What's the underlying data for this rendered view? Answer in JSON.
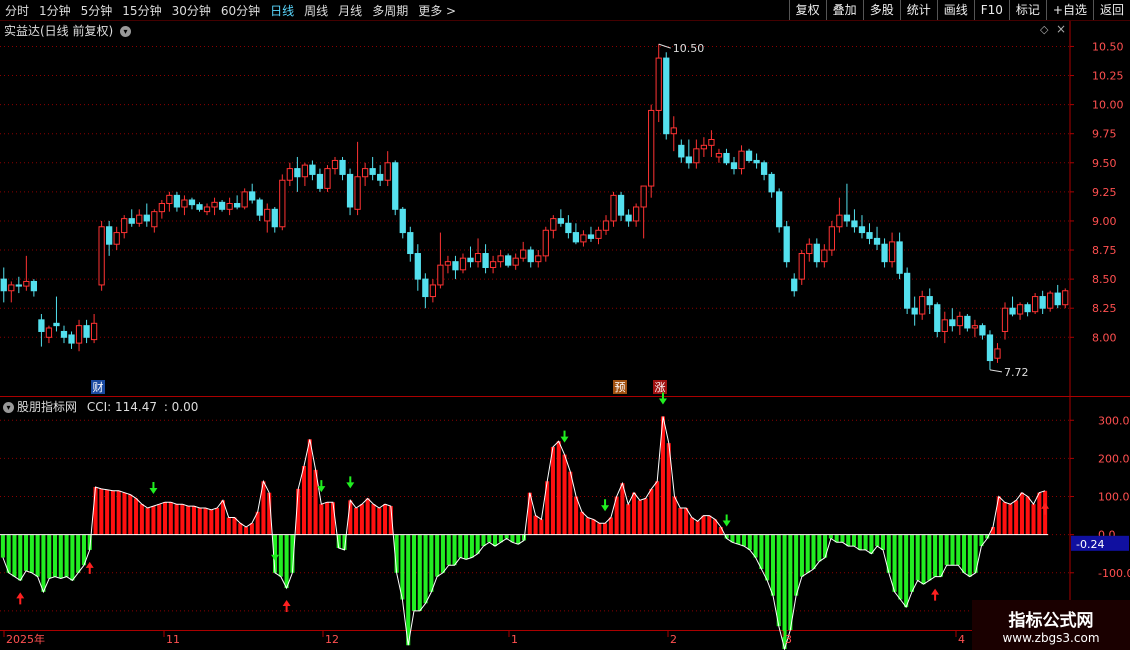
{
  "toolbar": {
    "timeframes": [
      "分时",
      "1分钟",
      "5分钟",
      "15分钟",
      "30分钟",
      "60分钟",
      "日线",
      "周线",
      "月线",
      "多周期",
      "更多 >"
    ],
    "active_index": 6,
    "right_buttons": [
      "复权",
      "叠加",
      "多股",
      "统计",
      "画线",
      "F10",
      "标记",
      "+自选",
      "返回"
    ]
  },
  "main_panel": {
    "title": "实益达(日线 前复权)",
    "badges": [
      "财",
      "预",
      "涨"
    ],
    "high_label": "10.50",
    "low_label": "7.72"
  },
  "indicator_panel": {
    "title": "股朋指标网",
    "cci_label": "CCI: 114.47",
    "extra_label": ": 0.00",
    "current_value_label": "-0.24"
  },
  "x_axis_labels": [
    "2025年",
    "11",
    "12",
    "1",
    "2",
    "3",
    "4"
  ],
  "watermark": {
    "title": "指标公式网",
    "url": "www.zbgs3.com"
  },
  "colors": {
    "up": "#ff3333",
    "down": "#54e0ee",
    "cci_pos": "#ff1010",
    "cci_neg": "#22ee22",
    "grid": "#8a0000"
  },
  "chart_data": [
    {
      "type": "candlestick",
      "title": "实益达(日线 前复权)",
      "ylim": [
        7.65,
        10.65
      ],
      "yticks": [
        8.0,
        8.25,
        8.5,
        8.75,
        9.0,
        9.25,
        9.5,
        9.75,
        10.0,
        10.25,
        10.5
      ],
      "ohlc": [
        [
          8.5,
          8.6,
          8.3,
          8.4
        ],
        [
          8.4,
          8.48,
          8.3,
          8.45
        ],
        [
          8.45,
          8.52,
          8.38,
          8.44
        ],
        [
          8.44,
          8.7,
          8.4,
          8.48
        ],
        [
          8.48,
          8.5,
          8.35,
          8.4
        ],
        [
          8.15,
          8.2,
          7.92,
          8.05
        ],
        [
          8.0,
          8.1,
          7.95,
          8.08
        ],
        [
          8.12,
          8.35,
          8.05,
          8.1
        ],
        [
          8.05,
          8.1,
          7.95,
          8.0
        ],
        [
          8.02,
          8.05,
          7.9,
          7.95
        ],
        [
          7.95,
          8.15,
          7.88,
          8.1
        ],
        [
          8.1,
          8.15,
          7.95,
          8.0
        ],
        [
          7.98,
          8.2,
          7.95,
          8.12
        ],
        [
          8.45,
          9.0,
          8.4,
          8.95
        ],
        [
          8.95,
          9.0,
          8.7,
          8.8
        ],
        [
          8.8,
          8.95,
          8.75,
          8.9
        ],
        [
          8.9,
          9.05,
          8.85,
          9.02
        ],
        [
          9.02,
          9.1,
          8.95,
          8.98
        ],
        [
          8.98,
          9.1,
          8.95,
          9.05
        ],
        [
          9.05,
          9.15,
          8.95,
          9.0
        ],
        [
          8.95,
          9.1,
          8.9,
          9.08
        ],
        [
          9.08,
          9.18,
          9.02,
          9.15
        ],
        [
          9.15,
          9.25,
          9.08,
          9.22
        ],
        [
          9.22,
          9.25,
          9.08,
          9.12
        ],
        [
          9.12,
          9.22,
          9.05,
          9.18
        ],
        [
          9.18,
          9.2,
          9.1,
          9.14
        ],
        [
          9.14,
          9.16,
          9.08,
          9.1
        ],
        [
          9.08,
          9.15,
          9.05,
          9.12
        ],
        [
          9.12,
          9.2,
          9.05,
          9.16
        ],
        [
          9.16,
          9.18,
          9.08,
          9.1
        ],
        [
          9.1,
          9.2,
          9.05,
          9.15
        ],
        [
          9.15,
          9.22,
          9.1,
          9.12
        ],
        [
          9.12,
          9.28,
          9.1,
          9.25
        ],
        [
          9.25,
          9.32,
          9.15,
          9.18
        ],
        [
          9.18,
          9.2,
          9.0,
          9.05
        ],
        [
          9.0,
          9.15,
          8.9,
          9.1
        ],
        [
          9.1,
          9.12,
          8.9,
          8.95
        ],
        [
          8.95,
          9.4,
          8.92,
          9.35
        ],
        [
          9.35,
          9.5,
          9.3,
          9.45
        ],
        [
          9.45,
          9.55,
          9.25,
          9.38
        ],
        [
          9.38,
          9.5,
          9.3,
          9.48
        ],
        [
          9.48,
          9.52,
          9.35,
          9.4
        ],
        [
          9.4,
          9.45,
          9.25,
          9.28
        ],
        [
          9.28,
          9.48,
          9.25,
          9.45
        ],
        [
          9.45,
          9.55,
          9.4,
          9.52
        ],
        [
          9.52,
          9.55,
          9.35,
          9.4
        ],
        [
          9.4,
          9.45,
          9.05,
          9.12
        ],
        [
          9.1,
          9.68,
          9.05,
          9.38
        ],
        [
          9.38,
          9.5,
          9.3,
          9.45
        ],
        [
          9.45,
          9.55,
          9.35,
          9.4
        ],
        [
          9.4,
          9.48,
          9.3,
          9.35
        ],
        [
          9.35,
          9.6,
          9.3,
          9.5
        ],
        [
          9.5,
          9.52,
          9.05,
          9.1
        ],
        [
          9.1,
          9.12,
          8.85,
          8.9
        ],
        [
          8.9,
          8.95,
          8.65,
          8.72
        ],
        [
          8.72,
          8.8,
          8.4,
          8.5
        ],
        [
          8.5,
          8.55,
          8.25,
          8.35
        ],
        [
          8.35,
          8.5,
          8.3,
          8.45
        ],
        [
          8.45,
          8.9,
          8.42,
          8.62
        ],
        [
          8.62,
          8.7,
          8.55,
          8.65
        ],
        [
          8.65,
          8.7,
          8.5,
          8.58
        ],
        [
          8.58,
          8.72,
          8.55,
          8.68
        ],
        [
          8.68,
          8.78,
          8.6,
          8.65
        ],
        [
          8.65,
          8.85,
          8.6,
          8.72
        ],
        [
          8.72,
          8.8,
          8.55,
          8.6
        ],
        [
          8.6,
          8.7,
          8.55,
          8.65
        ],
        [
          8.65,
          8.75,
          8.6,
          8.7
        ],
        [
          8.7,
          8.72,
          8.6,
          8.62
        ],
        [
          8.62,
          8.72,
          8.58,
          8.68
        ],
        [
          8.68,
          8.82,
          8.65,
          8.75
        ],
        [
          8.75,
          8.78,
          8.6,
          8.65
        ],
        [
          8.65,
          8.75,
          8.6,
          8.7
        ],
        [
          8.7,
          8.95,
          8.65,
          8.92
        ],
        [
          8.92,
          9.05,
          8.85,
          9.02
        ],
        [
          9.02,
          9.1,
          8.95,
          8.98
        ],
        [
          8.98,
          9.05,
          8.85,
          8.9
        ],
        [
          8.9,
          8.98,
          8.8,
          8.82
        ],
        [
          8.82,
          8.92,
          8.78,
          8.88
        ],
        [
          8.88,
          8.95,
          8.82,
          8.85
        ],
        [
          8.85,
          8.95,
          8.8,
          8.92
        ],
        [
          8.92,
          9.05,
          8.88,
          9.0
        ],
        [
          9.0,
          9.25,
          8.95,
          9.22
        ],
        [
          9.22,
          9.25,
          9.0,
          9.05
        ],
        [
          9.05,
          9.1,
          8.95,
          9.0
        ],
        [
          9.0,
          9.15,
          8.95,
          9.12
        ],
        [
          9.12,
          9.2,
          8.85,
          9.3
        ],
        [
          9.3,
          10.0,
          9.2,
          9.95
        ],
        [
          9.95,
          10.52,
          9.85,
          10.4
        ],
        [
          10.4,
          10.45,
          9.7,
          9.75
        ],
        [
          9.75,
          9.9,
          9.6,
          9.8
        ],
        [
          9.65,
          9.7,
          9.5,
          9.55
        ],
        [
          9.55,
          9.7,
          9.45,
          9.5
        ],
        [
          9.5,
          9.7,
          9.45,
          9.62
        ],
        [
          9.62,
          9.72,
          9.55,
          9.65
        ],
        [
          9.65,
          9.78,
          9.55,
          9.7
        ],
        [
          9.55,
          9.62,
          9.5,
          9.58
        ],
        [
          9.58,
          9.62,
          9.48,
          9.5
        ],
        [
          9.5,
          9.55,
          9.4,
          9.45
        ],
        [
          9.45,
          9.65,
          9.4,
          9.6
        ],
        [
          9.6,
          9.62,
          9.5,
          9.52
        ],
        [
          9.52,
          9.58,
          9.45,
          9.5
        ],
        [
          9.5,
          9.52,
          9.35,
          9.4
        ],
        [
          9.4,
          9.42,
          9.2,
          9.25
        ],
        [
          9.25,
          9.28,
          8.9,
          8.95
        ],
        [
          8.95,
          9.0,
          8.6,
          8.65
        ],
        [
          8.5,
          8.55,
          8.35,
          8.4
        ],
        [
          8.5,
          8.75,
          8.45,
          8.72
        ],
        [
          8.72,
          8.85,
          8.65,
          8.8
        ],
        [
          8.8,
          8.85,
          8.6,
          8.65
        ],
        [
          8.65,
          8.8,
          8.6,
          8.75
        ],
        [
          8.75,
          9.0,
          8.7,
          8.95
        ],
        [
          8.95,
          9.2,
          8.9,
          9.05
        ],
        [
          9.05,
          9.32,
          8.95,
          9.0
        ],
        [
          9.0,
          9.1,
          8.9,
          8.95
        ],
        [
          8.95,
          9.05,
          8.85,
          8.9
        ],
        [
          8.9,
          8.98,
          8.8,
          8.85
        ],
        [
          8.85,
          8.95,
          8.75,
          8.8
        ],
        [
          8.8,
          8.85,
          8.6,
          8.65
        ],
        [
          8.65,
          8.9,
          8.6,
          8.82
        ],
        [
          8.82,
          8.9,
          8.5,
          8.55
        ],
        [
          8.55,
          8.6,
          8.2,
          8.25
        ],
        [
          8.25,
          8.35,
          8.1,
          8.2
        ],
        [
          8.2,
          8.4,
          8.15,
          8.35
        ],
        [
          8.35,
          8.42,
          8.2,
          8.28
        ],
        [
          8.28,
          8.3,
          8.0,
          8.05
        ],
        [
          8.05,
          8.22,
          7.95,
          8.15
        ],
        [
          8.15,
          8.25,
          8.05,
          8.1
        ],
        [
          8.1,
          8.22,
          8.02,
          8.18
        ],
        [
          8.18,
          8.2,
          8.05,
          8.08
        ],
        [
          8.08,
          8.15,
          8.0,
          8.1
        ],
        [
          8.1,
          8.12,
          7.98,
          8.02
        ],
        [
          8.02,
          8.06,
          7.72,
          7.8
        ],
        [
          7.82,
          7.95,
          7.78,
          7.9
        ],
        [
          8.05,
          8.3,
          7.98,
          8.25
        ],
        [
          8.25,
          8.35,
          8.18,
          8.2
        ],
        [
          8.2,
          8.3,
          8.15,
          8.28
        ],
        [
          8.28,
          8.3,
          8.18,
          8.22
        ],
        [
          8.22,
          8.38,
          8.2,
          8.35
        ],
        [
          8.35,
          8.4,
          8.2,
          8.25
        ],
        [
          8.25,
          8.4,
          8.22,
          8.38
        ],
        [
          8.38,
          8.45,
          8.25,
          8.28
        ],
        [
          8.28,
          8.42,
          8.25,
          8.4
        ]
      ]
    },
    {
      "type": "bar",
      "title": "CCI",
      "ylim": [
        -250,
        340
      ],
      "yticks": [
        -200,
        -100,
        0,
        100,
        200,
        300
      ],
      "values": [
        -60,
        -100,
        -110,
        -120,
        -95,
        -100,
        -110,
        -150,
        -115,
        -110,
        -115,
        -110,
        -120,
        -100,
        -80,
        -40,
        125,
        120,
        118,
        115,
        115,
        110,
        105,
        95,
        80,
        70,
        75,
        80,
        85,
        85,
        80,
        80,
        75,
        75,
        70,
        70,
        65,
        70,
        90,
        45,
        45,
        30,
        20,
        30,
        60,
        140,
        110,
        -100,
        -110,
        -140,
        -100,
        120,
        180,
        250,
        170,
        80,
        85,
        85,
        -35,
        -40,
        90,
        70,
        80,
        95,
        80,
        70,
        80,
        75,
        -100,
        -170,
        -290,
        -200,
        -200,
        -180,
        -150,
        -110,
        -100,
        -80,
        -80,
        -60,
        -65,
        -60,
        -50,
        -30,
        -20,
        -30,
        -20,
        -10,
        -20,
        -25,
        -15,
        110,
        50,
        40,
        140,
        230,
        245,
        210,
        165,
        100,
        60,
        45,
        40,
        30,
        30,
        45,
        100,
        135,
        80,
        110,
        90,
        95,
        120,
        140,
        310,
        240,
        100,
        70,
        70,
        45,
        35,
        50,
        50,
        40,
        20,
        -10,
        -20,
        -25,
        -30,
        -40,
        -60,
        -90,
        -120,
        -160,
        -240,
        -300,
        -250,
        -160,
        -110,
        -100,
        -90,
        -70,
        -60,
        -10,
        -20,
        -20,
        -30,
        -30,
        -40,
        -40,
        -50,
        -30,
        -40,
        -100,
        -150,
        -170,
        -190,
        -150,
        -120,
        -130,
        -120,
        -110,
        -110,
        -80,
        -80,
        -80,
        -100,
        -110,
        -100,
        -30,
        -10,
        20,
        100,
        85,
        80,
        90,
        110,
        100,
        80,
        110,
        115
      ]
    }
  ]
}
